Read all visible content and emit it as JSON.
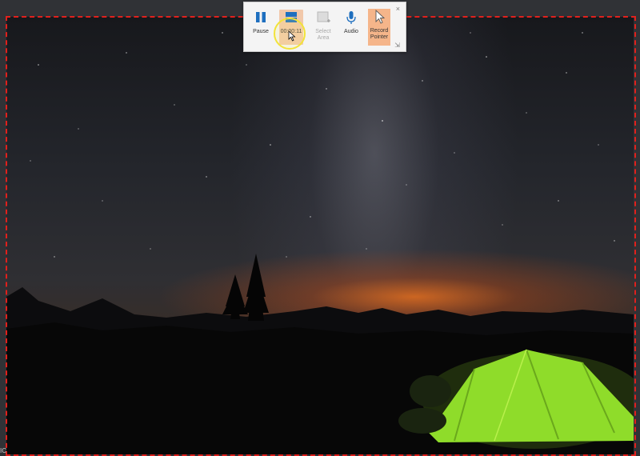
{
  "toolbar": {
    "pause_label": "Pause",
    "timer_label": "00:00:11",
    "select_area_label": "Select Area",
    "audio_label": "Audio",
    "record_pointer_label": "Record Pointer",
    "close_symbol": "×",
    "pin_symbol": "⇲"
  },
  "edge_text": "IC",
  "colors": {
    "recording_border": "#e0201c",
    "toolbar_bg": "#f4f4f4",
    "timer_highlight": "#f1c8aa",
    "pointer_active": "#f5b58a",
    "cursor_halo": "#f2e33a",
    "tent_green": "#8fdc2a"
  }
}
